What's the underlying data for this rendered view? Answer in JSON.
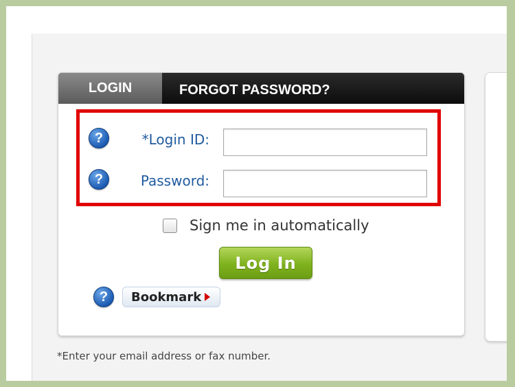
{
  "tabs": {
    "login": "LOGIN",
    "forgot_password": "FORGOT PASSWORD?"
  },
  "fields": {
    "login_id": {
      "label": "*Login ID:",
      "value": "",
      "placeholder": ""
    },
    "password": {
      "label": "Password:",
      "value": "",
      "placeholder": ""
    }
  },
  "help_icon_glyph": "?",
  "remember": {
    "label": "Sign me in automatically",
    "checked": false
  },
  "buttons": {
    "login": "Log In",
    "bookmark": "Bookmark"
  },
  "footnote": "*Enter your email address or fax number.",
  "colors": {
    "highlight": "#e00000",
    "login_button": "#7fb21e",
    "label_text": "#1f5a9e",
    "help_icon": "#1d5cb3",
    "page_border": "#b9cc9f"
  }
}
